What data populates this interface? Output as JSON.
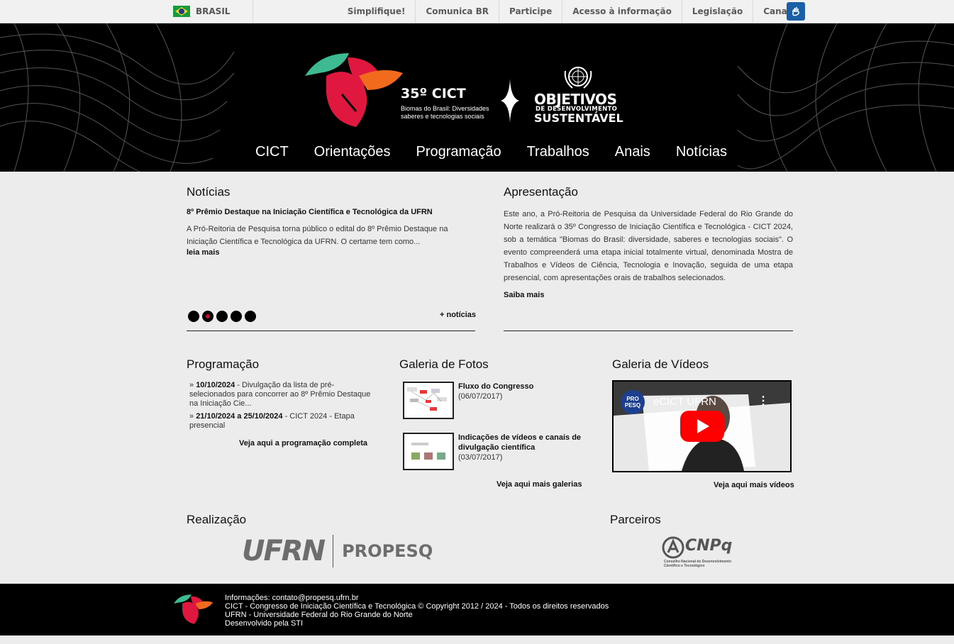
{
  "govbar": {
    "country": "BRASIL",
    "links": [
      "Simplifique!",
      "Comunica BR",
      "Participe",
      "Acesso à informação",
      "Legislação",
      "Canais"
    ]
  },
  "header": {
    "event_title": "35º CICT",
    "event_subtitle": "Biomas do Brasil: Diversidades saberes e tecnologias sociais",
    "ods_line1": "OBJETIVOS",
    "ods_line2": "DE DESENVOLVIMENTO",
    "ods_line3": "SUSTENTÁVEL",
    "nav": [
      "CICT",
      "Orientações",
      "Programação",
      "Trabalhos",
      "Anais",
      "Notícias"
    ]
  },
  "noticias": {
    "heading": "Notícias",
    "item_title": "8º Prêmio Destaque na Iniciação Científica e Tecnológica da UFRN",
    "item_body": "A Pró-Reitoria de Pesquisa torna público o edital do 8º Prêmio Destaque na Iniciação Científica e Tecnológica da UFRN. O certame tem como...",
    "read_more": "leia mais",
    "more_news": "+ notícias",
    "slides": 5,
    "active_slide": 2
  },
  "apresentacao": {
    "heading": "Apresentação",
    "body": "Este ano, a Pró-Reitoria de Pesquisa da Universidade Federal do Rio Grande do Norte realizará o 35º Congresso de Iniciação Científica e Tecnológica - CICT 2024, sob a temática \"Biomas do Brasil: diversidade, saberes e tecnologias sociais\". O evento compreenderá uma etapa inicial totalmente virtual, denominada Mostra de Trabalhos e Vídeos de Ciência, Tecnologia e Inovação, seguida de uma etapa presencial, com apresentações orais de trabalhos selecionados.",
    "more": "Saiba mais"
  },
  "programacao": {
    "heading": "Programação",
    "items": [
      {
        "date": "10/10/2024",
        "text": " - Divulgação da lista de pré-selecionados para concorrer ao 8º Prêmio Destaque na Iniciação Cie..."
      },
      {
        "date": "21/10/2024 a 25/10/2024",
        "text": " - CICT 2024 - Etapa presencial"
      }
    ],
    "link": "Veja aqui a programação completa"
  },
  "galeria": {
    "heading": "Galeria de Fotos",
    "items": [
      {
        "title": "Fluxo do Congresso",
        "date": "(06/07/2017)"
      },
      {
        "title": "Indicações de vídeos e canais de divulgação científica",
        "date": "(03/07/2017)"
      }
    ],
    "link": "Veja aqui mais galerias"
  },
  "videos": {
    "heading": "Galeria de Vídeos",
    "video_title": "eCICT UFRN",
    "channel_badge": "PRO PESQ",
    "link": "Veja aqui mais vídeos"
  },
  "realizacao": {
    "heading": "Realização",
    "logo_left": "UFRN",
    "logo_right": "PROPESQ"
  },
  "parceiros": {
    "heading": "Parceiros",
    "logo": "CNPq",
    "logo_sub": "Conselho Nacional de Desenvolvimento Científico e Tecnológico"
  },
  "footer": {
    "lines": [
      "Informações: contato@propesq.ufrn.br",
      "CICT - Congresso de Iniciação Científica e Tecnológica © Copyright 2012 / 2024 - Todos os direitos reservados",
      "UFRN - Universidade Federal do Rio Grande do Norte",
      "Desenvolvido pela STI"
    ]
  },
  "colors": {
    "brand_red": "#e0183f",
    "brand_orange": "#f26a1c",
    "brand_teal": "#3dba92",
    "header_bg": "#000000"
  }
}
